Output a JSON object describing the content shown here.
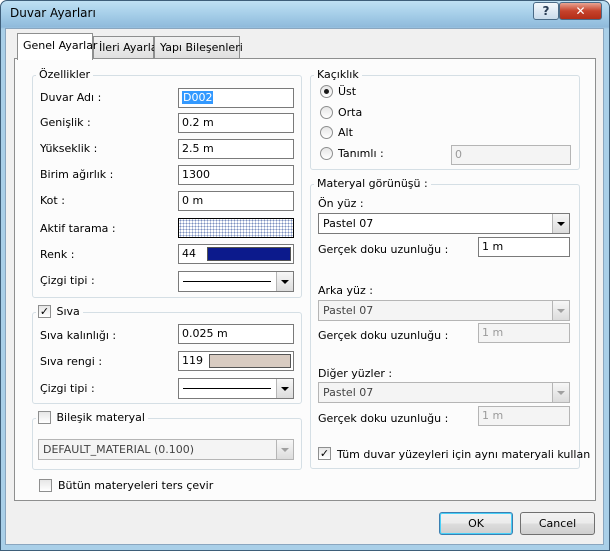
{
  "window": {
    "title": "Duvar Ayarları",
    "help_label": "?",
    "close_label": "✕"
  },
  "tabs": [
    {
      "label": "Genel Ayarlar"
    },
    {
      "label": "İleri Ayarlar"
    },
    {
      "label": "Yapı Bileşenleri"
    }
  ],
  "properties": {
    "title": "Özellikler",
    "name_label": "Duvar Adı :",
    "name_value": "D002",
    "width_label": "Genişlik :",
    "width_value": "0.2 m",
    "height_label": "Yükseklik :",
    "height_value": "2.5 m",
    "unit_weight_label": "Birim ağırlık :",
    "unit_weight_value": "1300",
    "elevation_label": "Kot :",
    "elevation_value": "0 m",
    "hatch_label": "Aktif tarama :",
    "color_label": "Renk :",
    "color_value": "44",
    "color_hex": "#0c1a8c",
    "linetype_label": "Çizgi tipi :"
  },
  "plaster": {
    "title": "Sıva",
    "checked": "✓",
    "thickness_label": "Sıva kalınlığı :",
    "thickness_value": "0.025 m",
    "color_label": "Sıva rengi :",
    "color_value": "119",
    "color_hex": "#d8cbc1",
    "linetype_label": "Çizgi tipi :"
  },
  "composite": {
    "title": "Bileşik materyal",
    "value": "DEFAULT_MATERIAL (0.100)"
  },
  "invert_label": "Bütün materyeleri ters çevir",
  "offset": {
    "title": "Kaçıklık",
    "options": [
      "Üst",
      "Orta",
      "Alt",
      "Tanımlı :"
    ],
    "defined_value": "0"
  },
  "material": {
    "title": "Materyal görünüşü :",
    "front_label": "Ön yüz :",
    "front_value": "Pastel 07",
    "front_len_label": "Gerçek doku uzunluğu :",
    "front_len_value": "1 m",
    "back_label": "Arka yüz :",
    "back_value": "Pastel 07",
    "back_len_label": "Gerçek doku uzunluğu :",
    "back_len_value": "1 m",
    "other_label": "Diğer yüzler :",
    "other_value": "Pastel 07",
    "other_len_label": "Gerçek doku uzunluğu :",
    "other_len_value": "1 m",
    "same_label": "Tüm duvar yüzeyleri için aynı materyali kullan",
    "same_checked": "✓"
  },
  "buttons": {
    "ok": "OK",
    "cancel": "Cancel"
  }
}
